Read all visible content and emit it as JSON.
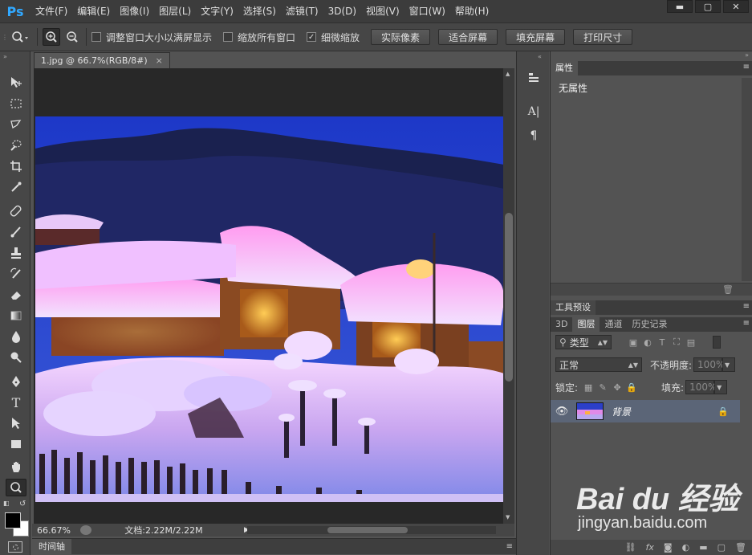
{
  "app": {
    "logo": "Ps"
  },
  "menu": [
    "文件(F)",
    "编辑(E)",
    "图像(I)",
    "图层(L)",
    "文字(Y)",
    "选择(S)",
    "滤镜(T)",
    "3D(D)",
    "视图(V)",
    "窗口(W)",
    "帮助(H)"
  ],
  "window_buttons": {
    "minimize": "▬",
    "restore": "▢",
    "close": "✕"
  },
  "options_bar": {
    "tool_icon": "zoom-icon",
    "resize_windows_label": "调整窗口大小以满屏显示",
    "resize_windows_checked": false,
    "zoom_all_label": "缩放所有窗口",
    "zoom_all_checked": false,
    "scrubby_zoom_label": "细微缩放",
    "scrubby_zoom_checked": true,
    "buttons": [
      "实际像素",
      "适合屏幕",
      "填充屏幕",
      "打印尺寸"
    ]
  },
  "document": {
    "tab_title": "1.jpg @ 66.7%(RGB/8#)",
    "tab_close": "×",
    "zoom": "66.67%",
    "doc_info": "文档:2.22M/2.22M"
  },
  "timeline": {
    "label": "时间轴"
  },
  "properties_panel": {
    "title": "属性",
    "body_text": "无属性"
  },
  "tool_presets_panel": {
    "title": "工具预设"
  },
  "layers_panel": {
    "tabs": [
      "3D",
      "图层",
      "通道",
      "历史记录"
    ],
    "active_tab": "图层",
    "filter_kind": "类型",
    "blend_mode": "正常",
    "opacity_label": "不透明度:",
    "opacity_value": "100%",
    "lock_label": "锁定:",
    "fill_label": "填充:",
    "fill_value": "100%",
    "layers": [
      {
        "name": "背景",
        "visible": true,
        "locked": true
      }
    ]
  },
  "watermark": {
    "brand": "Bai du 经验",
    "url": "jingyan.baidu.com"
  },
  "colors": {
    "ps_blue": "#31a8ff",
    "selected_layer": "#5b6577"
  }
}
